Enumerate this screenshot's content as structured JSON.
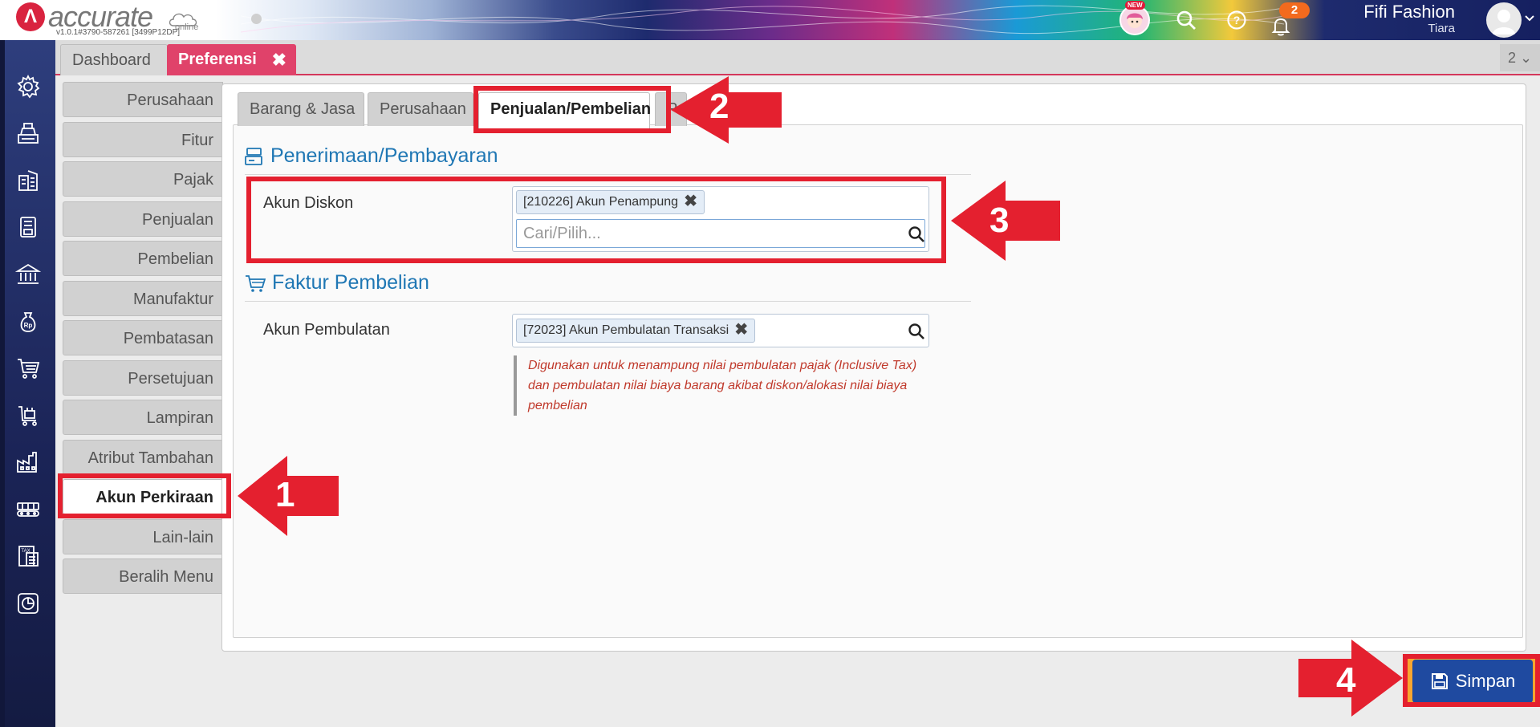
{
  "app": {
    "logo_letter": "Λ",
    "logo_word": "accurate",
    "logo_sub": "online",
    "version": "v1.0.1#3790-587261 [3499P12DP]"
  },
  "topbar": {
    "new_badge": "NEW",
    "notification_count": "2",
    "user_name": "Fifi Fashion",
    "user_sub": "Tiara"
  },
  "main_tabs": {
    "dashboard": "Dashboard",
    "preferensi": "Preferensi",
    "close": "✖",
    "count": "2 ⌄"
  },
  "left_icons": [
    "gear-icon",
    "cash-register-icon",
    "buildings-icon",
    "book-icon",
    "bank-icon",
    "money-bag-icon",
    "cart-icon",
    "warehouse-cart-icon",
    "factory-icon",
    "conveyor-icon",
    "tax-report-icon",
    "chart-report-icon"
  ],
  "pref_menu": {
    "items": [
      "Perusahaan",
      "Fitur",
      "Pajak",
      "Penjualan",
      "Pembelian",
      "Manufaktur",
      "Pembatasan",
      "Persetujuan",
      "Lampiran",
      "Atribut Tambahan",
      "Akun Perkiraan",
      "Lain-lain",
      "Beralih Menu"
    ],
    "active": "Akun Perkiraan"
  },
  "sub_tabs": {
    "items": [
      "Barang & Jasa",
      "Perusahaan",
      "Penjualan/Pembelian",
      "P"
    ],
    "active": "Penjualan/Pembelian"
  },
  "section1": {
    "title": "Penerimaan/Pembayaran",
    "field_label": "Akun Diskon",
    "tag": "[210226] Akun Penampung",
    "tag_remove": "✖",
    "search_placeholder": "Cari/Pilih..."
  },
  "section2": {
    "title": "Faktur Pembelian",
    "field_label": "Akun Pembulatan",
    "tag": "[72023] Akun Pembulatan Transaksi",
    "tag_remove": "✖",
    "hint": "Digunakan untuk menampung nilai pembulatan pajak (Inclusive Tax) dan pembulatan nilai biaya barang akibat diskon/alokasi nilai biaya pembelian"
  },
  "footer": {
    "save_label": "Simpan"
  },
  "annotations": {
    "step1": "1",
    "step2": "2",
    "step3": "3",
    "step4": "4",
    "color": "#e4202f"
  }
}
